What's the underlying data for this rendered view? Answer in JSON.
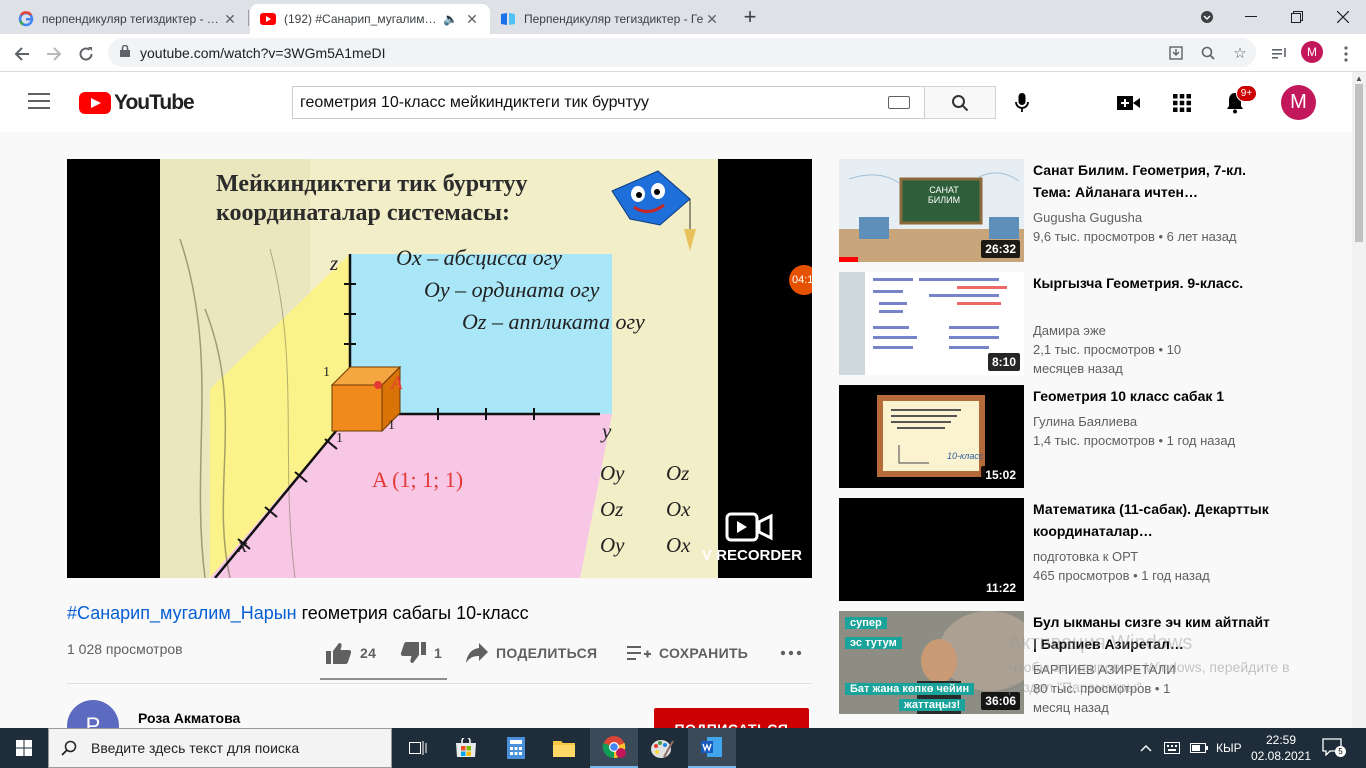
{
  "browser": {
    "tabs": [
      {
        "title": "перпендикуляр тегиздиктер - Go",
        "favicon": "google-icon"
      },
      {
        "title": "(192) #Санарип_мугалим_На",
        "favicon": "youtube-icon",
        "active": true
      },
      {
        "title": "Перпендикуляр тегиздиктер - Ге",
        "favicon": "book-icon"
      }
    ],
    "url": "youtube.com/watch?v=3WGm5A1meDI",
    "profile_initial": "M"
  },
  "youtube": {
    "logo_text": "YouTube",
    "search_query": "геометрия 10-класс мейкиндиктеги тик бурчтуу",
    "notification_count": "9+",
    "avatar_initial": "M"
  },
  "slide": {
    "title_line1": "Мейкиндиктеги тик бурчтуу",
    "title_line2": "координаталар системасы:",
    "ox": "Ox – абсцисса огу",
    "oy": "Oy – ордината огу",
    "oz": "Oz – аппликата огу",
    "point": "A (1; 1; 1)",
    "axis_z": "z",
    "axis_y": "y",
    "axis_x": "x",
    "point_label": "A",
    "one": "1",
    "pairs": [
      [
        "Oy",
        "Oz"
      ],
      [
        "Oz",
        "Ox"
      ],
      [
        "Oy",
        "Ox"
      ]
    ],
    "recorder_text": "V RECORDER",
    "time_chip": "04:1"
  },
  "video": {
    "hashtag": "#Санарип_мугалим_Нарын",
    "title_rest": " геометрия сабагы 10-класс",
    "views": "1 028 просмотров",
    "likes": "24",
    "dislikes": "1",
    "share_label": "ПОДЕЛИТЬСЯ",
    "save_label": "СОХРАНИТЬ",
    "channel_name": "Роза Акматова",
    "channel_initial": "Р",
    "subscribe_label": "ПОДПИСАТЬСЯ"
  },
  "recommendations": [
    {
      "title": "Санат Билим. Геометрия, 7-кл. Тема: Айланага ичтен…",
      "channel": "Gugusha Gugusha",
      "stats": "9,6 тыс. просмотров • 6 лет назад",
      "duration": "26:32",
      "thumb_text": "САНАТ БИЛИМ"
    },
    {
      "title": "Кыргызча Геометрия. 9-класс.",
      "channel": "Дамира эже",
      "stats": "2,1 тыс. просмотров • 10 месяцев назад",
      "duration": "8:10"
    },
    {
      "title": "Геометрия 10 класс сабак 1",
      "channel": "Гулина Баялиева",
      "stats": "1,4 тыс. просмотров • 1 год назад",
      "duration": "15:02",
      "thumb_text": "10-класс"
    },
    {
      "title": "Математика (11-сабак). Декарттык координаталар…",
      "channel": "подготовка к ОРТ",
      "stats": "465 просмотров • 1 год назад",
      "duration": "11:22"
    },
    {
      "title": "Бул ыкманы сизге эч ким айтпайт | Барпиев Азиретал…",
      "channel": "БАРПИЕВ АЗИРЕТАЛИ",
      "stats": "80 тыс. просмотров • 1 месяц назад",
      "duration": "36:06",
      "thumb_text1": "супер",
      "thumb_text2": "эс тутум",
      "thumb_text3": "Бат жана көпкө чейин",
      "thumb_text4": "жаттаңыз!"
    }
  ],
  "watermark": {
    "line1": "Активация Windows",
    "line2": "Чтобы активировать Windows, перейдите в",
    "line3": "раздел \"Параметры\"."
  },
  "taskbar": {
    "search_placeholder": "Введите здесь текст для поиска",
    "language": "КЫР",
    "time": "22:59",
    "date": "02.08.2021",
    "notifications": "5"
  }
}
